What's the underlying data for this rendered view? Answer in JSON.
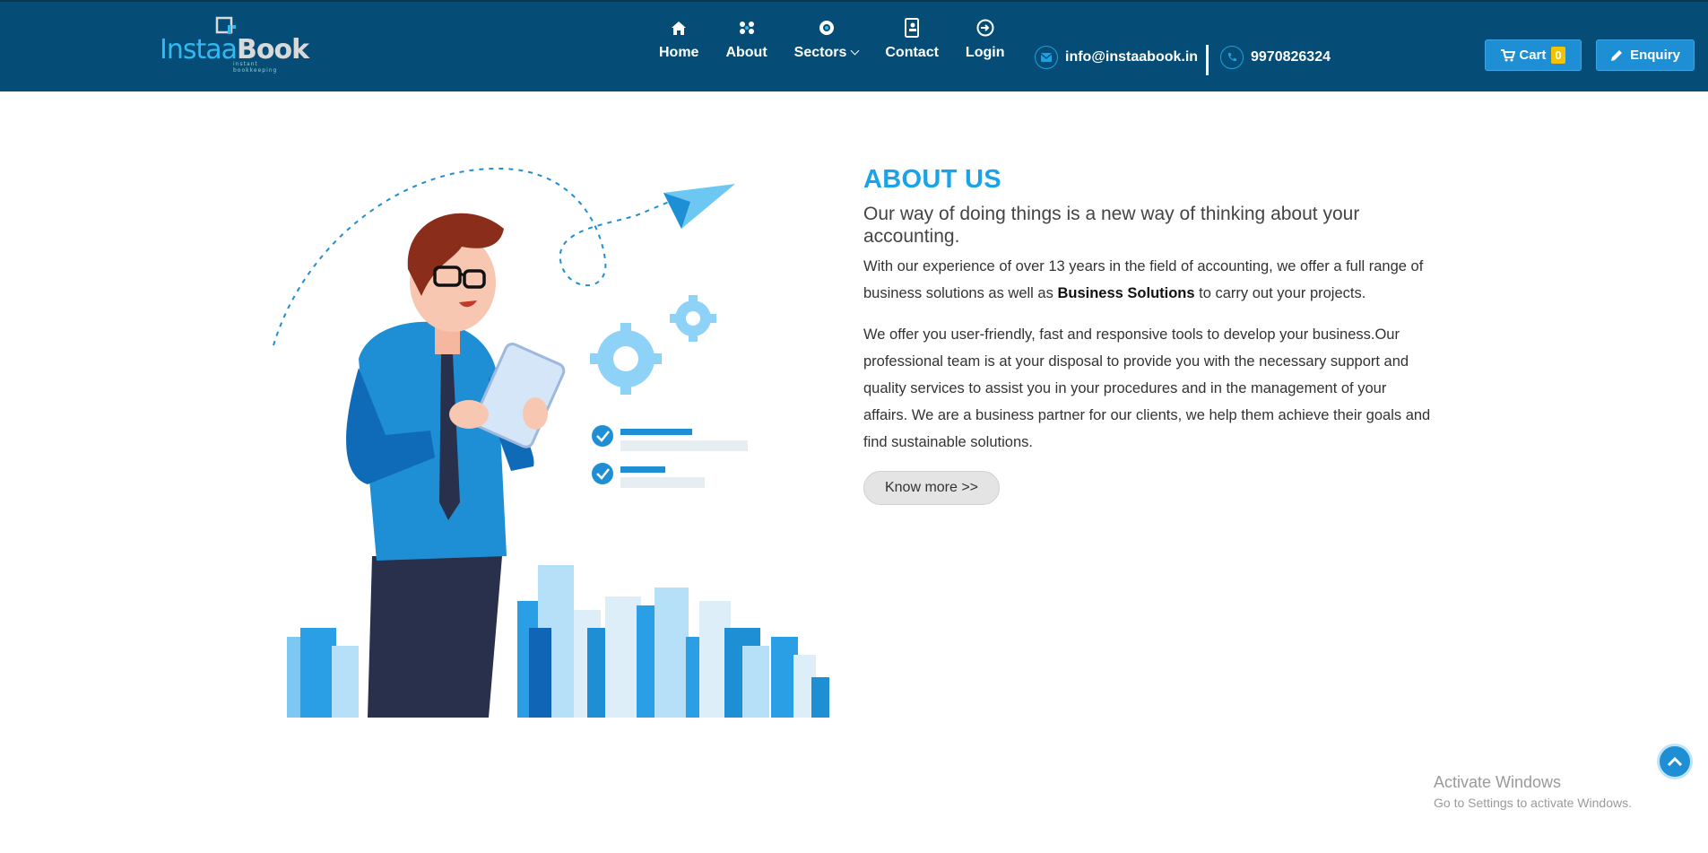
{
  "brand": {
    "logo_part1": "Instaa",
    "logo_part2": "Book",
    "tagline": "instant bookkeeping"
  },
  "nav": {
    "home": "Home",
    "about": "About",
    "sectors": "Sectors",
    "contact": "Contact",
    "login": "Login"
  },
  "contact_info": {
    "email": "info@instaabook.in",
    "phone": "9970826324"
  },
  "cart": {
    "label": "Cart",
    "count": "0"
  },
  "enquiry": {
    "label": "Enquiry"
  },
  "about": {
    "title": "ABOUT US",
    "subtitle": "Our way of doing things is a new way of thinking about your accounting.",
    "para1_before": "With our experience of over 13 years in the field of accounting, we offer a full range of business solutions as well as ",
    "para1_bold": "Business Solutions",
    "para1_after": " to carry out your projects.",
    "para2": "We offer you user-friendly, fast and responsive tools to develop your business.Our professional team is at your disposal to provide you with the necessary support and quality services to assist you in your procedures and in the management of your affairs. We are a business partner for our clients, we help them achieve their goals and find sustainable solutions.",
    "button": "Know more >>"
  },
  "watermark": {
    "line1": "Activate Windows",
    "line2": "Go to Settings to activate Windows."
  },
  "colors": {
    "header": "#054d76",
    "accent": "#1aa3e8",
    "button": "#1e8fd4",
    "badge": "#f3c200"
  },
  "icons": {
    "home": "home-icon",
    "about": "people-icon",
    "sectors": "sectors-icon",
    "contact": "contact-book-icon",
    "login": "login-icon",
    "email": "envelope-icon",
    "phone": "phone-icon",
    "cart": "cart-icon",
    "enquiry": "pencil-icon",
    "scroll": "chevron-up-icon"
  }
}
